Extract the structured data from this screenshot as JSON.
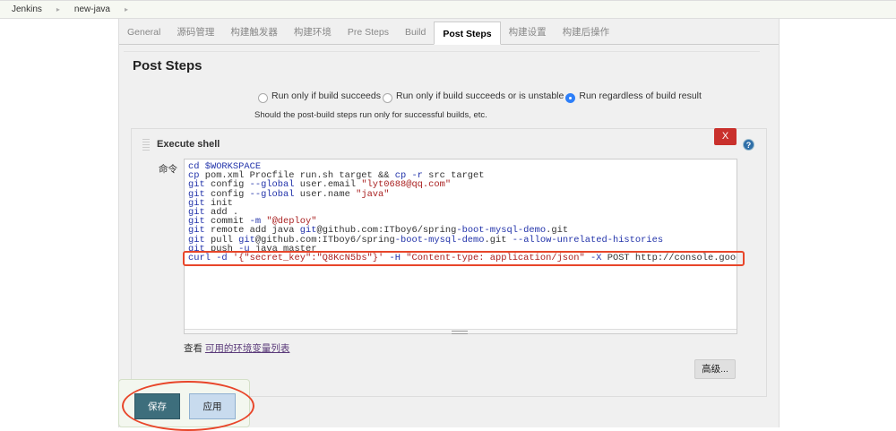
{
  "breadcrumb": [
    "Jenkins",
    "new-java"
  ],
  "tabs": [
    {
      "label": "General"
    },
    {
      "label": "源码管理"
    },
    {
      "label": "构建触发器"
    },
    {
      "label": "构建环境"
    },
    {
      "label": "Pre Steps"
    },
    {
      "label": "Build"
    },
    {
      "label": "Post Steps",
      "active": true
    },
    {
      "label": "构建设置"
    },
    {
      "label": "构建后操作"
    }
  ],
  "section_title": "Post Steps",
  "radios": [
    {
      "label": "Run only if build succeeds",
      "checked": false
    },
    {
      "label": "Run only if build succeeds or is unstable",
      "checked": false
    },
    {
      "label": "Run regardless of build result",
      "checked": true
    }
  ],
  "radio_hint": "Should the post-build steps run only for successful builds, etc.",
  "shell": {
    "title": "Execute shell",
    "delete_label": "X",
    "help_label": "?",
    "command_label": "命令",
    "code_lines": [
      [
        {
          "t": "cd ",
          "c": "kw"
        },
        {
          "t": "$WORKSPACE",
          "c": "kw"
        }
      ],
      [
        {
          "t": "cp",
          "c": "kw"
        },
        {
          "t": " pom.xml Procfile run.sh target && ",
          "c": ""
        },
        {
          "t": "cp -r",
          "c": "kw"
        },
        {
          "t": " src target",
          "c": ""
        }
      ],
      [
        {
          "t": "git",
          "c": "kw"
        },
        {
          "t": " config ",
          "c": ""
        },
        {
          "t": "--global",
          "c": "kw"
        },
        {
          "t": " user.email ",
          "c": ""
        },
        {
          "t": "\"lyt0688@qq.com\"",
          "c": "str"
        }
      ],
      [
        {
          "t": "git",
          "c": "kw"
        },
        {
          "t": " config ",
          "c": ""
        },
        {
          "t": "--global",
          "c": "kw"
        },
        {
          "t": " user.name ",
          "c": ""
        },
        {
          "t": "\"java\"",
          "c": "str"
        }
      ],
      [
        {
          "t": "git",
          "c": "kw"
        },
        {
          "t": " init",
          "c": ""
        }
      ],
      [
        {
          "t": "git",
          "c": "kw"
        },
        {
          "t": " add .",
          "c": ""
        }
      ],
      [
        {
          "t": "git",
          "c": "kw"
        },
        {
          "t": " commit ",
          "c": ""
        },
        {
          "t": "-m",
          "c": "kw"
        },
        {
          "t": " \"@deploy\"",
          "c": "str"
        }
      ],
      [
        {
          "t": "git",
          "c": "kw"
        },
        {
          "t": " remote add java ",
          "c": ""
        },
        {
          "t": "git",
          "c": "kw"
        },
        {
          "t": "@github.com:ITboy6/spring",
          "c": ""
        },
        {
          "t": "-boot-mysql-demo",
          "c": "kw"
        },
        {
          "t": ".git",
          "c": ""
        }
      ],
      [
        {
          "t": "git",
          "c": "kw"
        },
        {
          "t": " pull ",
          "c": ""
        },
        {
          "t": "git",
          "c": "kw"
        },
        {
          "t": "@github.com:ITboy6/spring",
          "c": ""
        },
        {
          "t": "-boot-mysql-demo",
          "c": "kw"
        },
        {
          "t": ".git ",
          "c": ""
        },
        {
          "t": "--allow-unrelated-histories",
          "c": "kw"
        }
      ],
      [
        {
          "t": "git",
          "c": "kw"
        },
        {
          "t": " push ",
          "c": ""
        },
        {
          "t": "-u",
          "c": "kw"
        },
        {
          "t": " java master",
          "c": ""
        }
      ],
      [
        {
          "t": "curl ",
          "c": "kw"
        },
        {
          "t": "-d",
          "c": "kw"
        },
        {
          "t": " '{\"secret_key\":\"Q8KcN5bs\"}'",
          "c": "str"
        },
        {
          "t": " -H",
          "c": "kw"
        },
        {
          "t": " \"Content-type: application/json\"",
          "c": "str"
        },
        {
          "t": " -X",
          "c": "kw"
        },
        {
          "t": " POST http://console.goodra",
          "c": ""
        }
      ]
    ],
    "env_prefix": "查看 ",
    "env_link": "可用的环境变量列表",
    "advanced_label": "高级..."
  },
  "buttons": {
    "save": "保存",
    "apply": "应用"
  }
}
